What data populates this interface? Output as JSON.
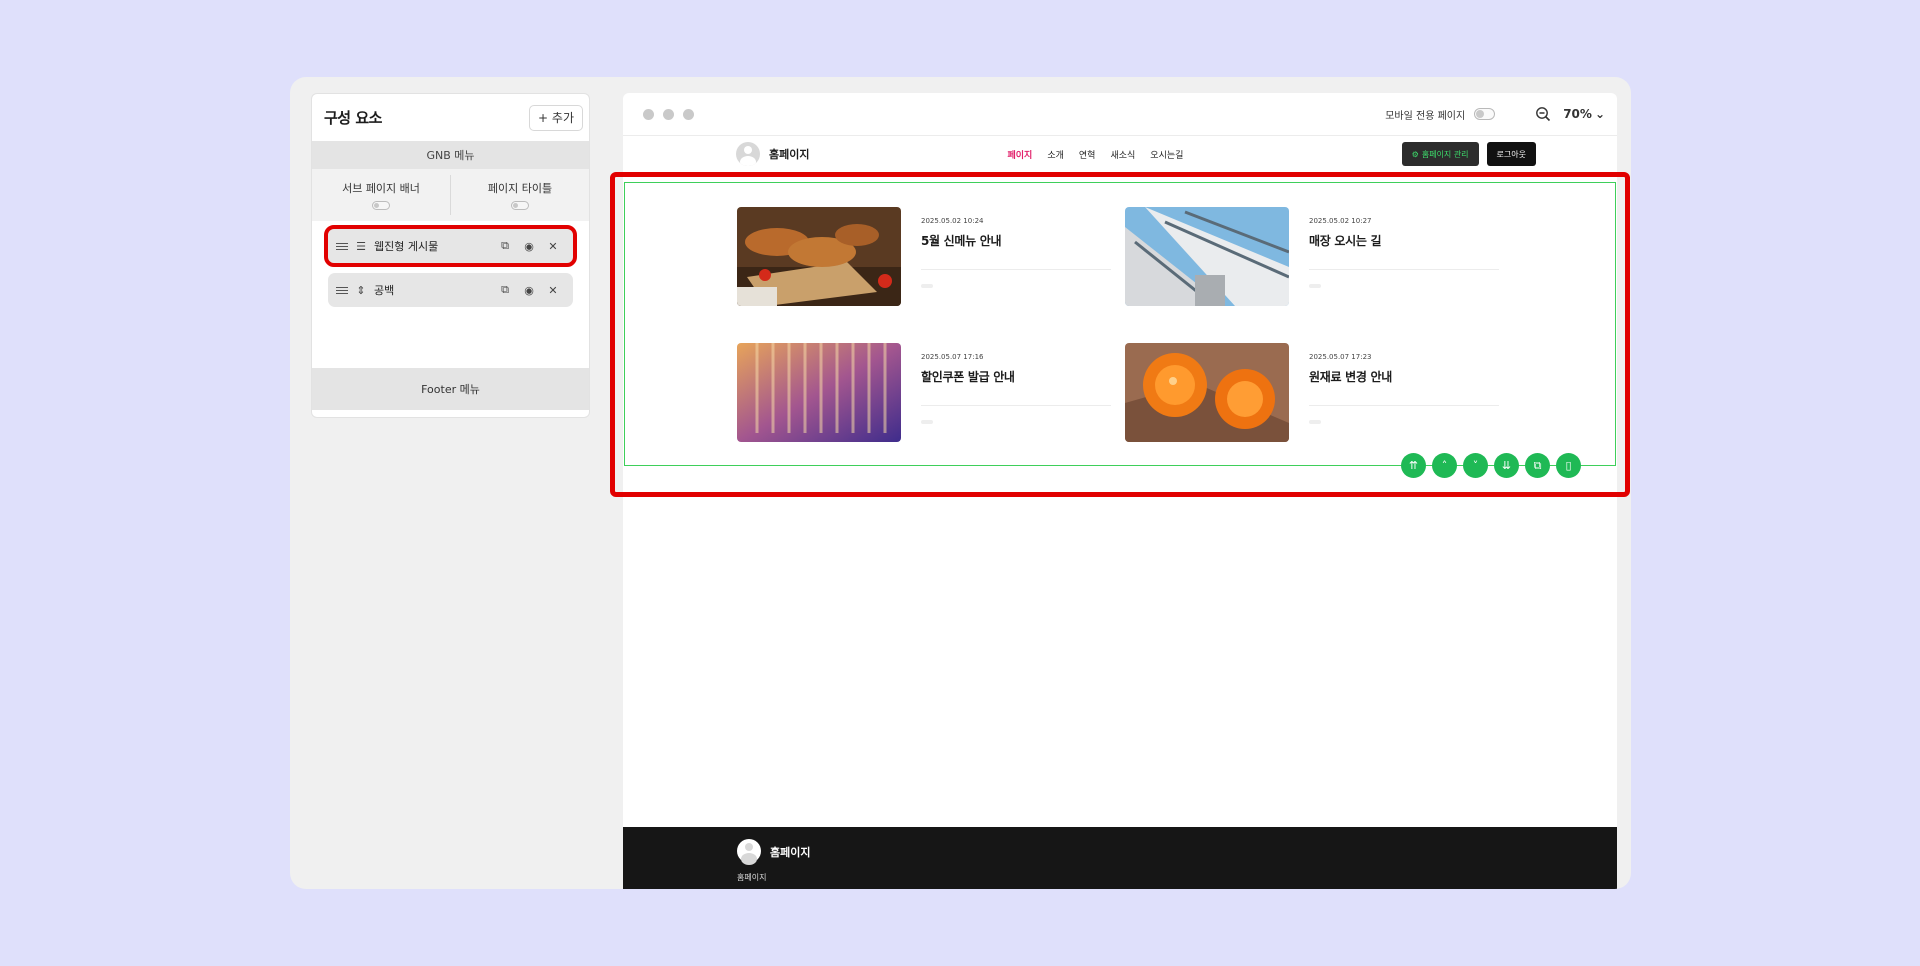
{
  "panel": {
    "title": "구성 요소",
    "add_label": "+ 추가",
    "gnb_label": "GNB 메뉴",
    "sub_banner_label": "서브 페이지 배너",
    "page_title_label": "페이지 타이틀",
    "items": [
      {
        "label": "웹진형 게시물",
        "icon": "list-icon"
      },
      {
        "label": "공백",
        "icon": "spacer-icon"
      }
    ],
    "footer_label": "Footer 메뉴"
  },
  "preview": {
    "mobile_label": "모바일 전용 페이지",
    "zoom": "70%",
    "site_name": "홈페이지",
    "menu": [
      "페이지",
      "소개",
      "연혁",
      "새소식",
      "오시는길"
    ],
    "manage_label": "홈페이지 관리",
    "logout_label": "로그아웃",
    "posts": [
      {
        "date": "2025.05.02 10:24",
        "title": "5월 신메뉴 안내",
        "thumb": "bread"
      },
      {
        "date": "2025.05.02 10:27",
        "title": "매장 오시는 길",
        "thumb": "building"
      },
      {
        "date": "2025.05.07 17:16",
        "title": "할인쿠폰 발급 안내",
        "thumb": "abstract"
      },
      {
        "date": "2025.05.07 17:23",
        "title": "원재료 변경 안내",
        "thumb": "orange"
      }
    ],
    "footer_name": "홈페이지",
    "footer_sub": "홈페이지"
  },
  "colors": {
    "accent_green": "#1fb955",
    "highlight_red": "#e10000",
    "menu_active": "#e2216b"
  }
}
